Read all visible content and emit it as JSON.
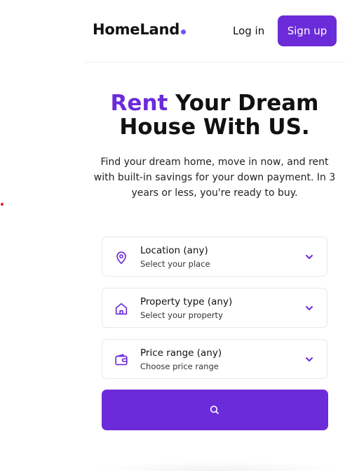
{
  "header": {
    "logo": "HomeLand",
    "login_label": "Log in",
    "signup_label": "Sign up"
  },
  "hero": {
    "title_accent": "Rent",
    "title_line1_rest": " Your Dream",
    "title_line2": "House With US.",
    "subtitle": "Find your dream home, move in now, and rent with built-in savings for your down payment. In 3 years or less, you're ready to buy."
  },
  "filters": [
    {
      "title": "Location (any)",
      "subtitle": "Select your place",
      "icon": "location-pin-icon"
    },
    {
      "title": "Property type (any)",
      "subtitle": "Select your property",
      "icon": "house-icon"
    },
    {
      "title": "Price range (any)",
      "subtitle": "Choose price range",
      "icon": "wallet-icon"
    }
  ],
  "search": {
    "icon": "search-icon"
  },
  "colors": {
    "accent": "#6c2bd9",
    "logo_dot": "#7a4cff"
  }
}
